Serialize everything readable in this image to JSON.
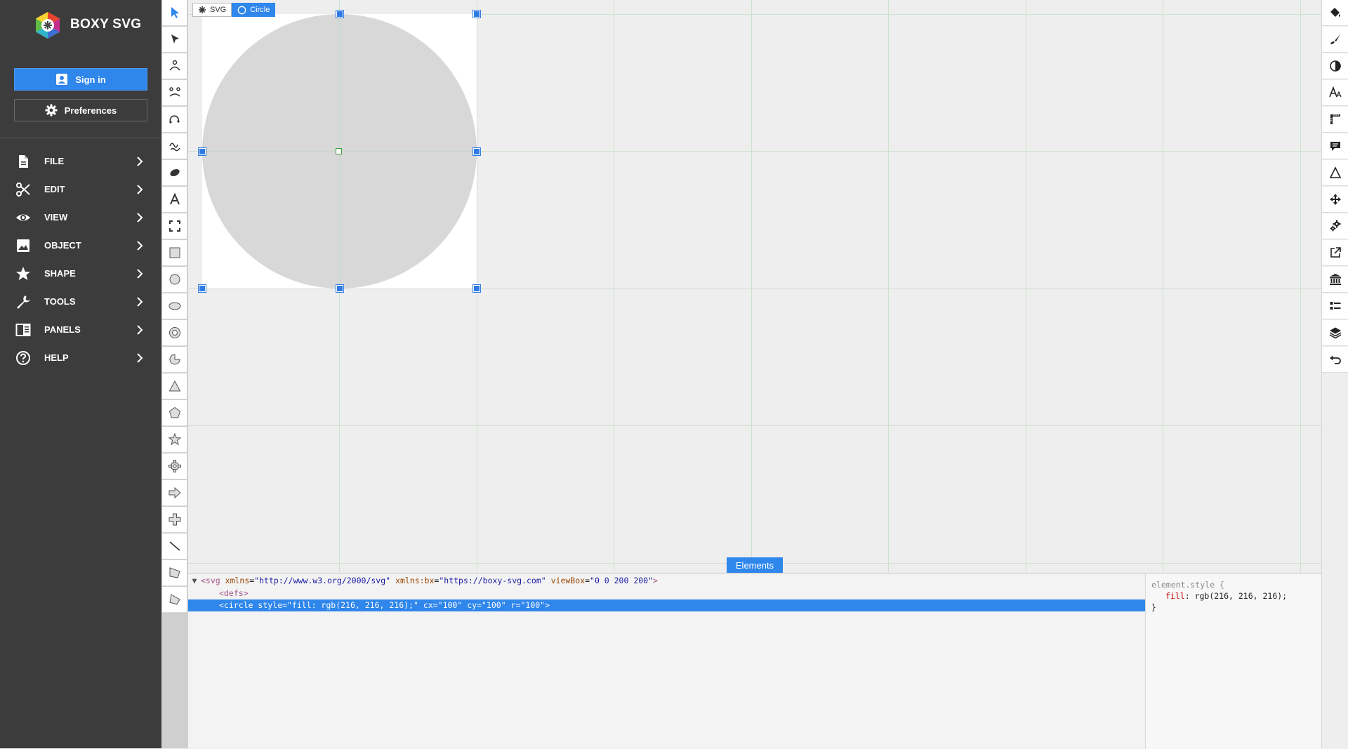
{
  "app": {
    "name": "BOXY SVG"
  },
  "sidebar": {
    "signin_label": "Sign in",
    "preferences_label": "Preferences",
    "menu": [
      {
        "label": "FILE",
        "icon": "file-icon"
      },
      {
        "label": "EDIT",
        "icon": "scissors-icon"
      },
      {
        "label": "VIEW",
        "icon": "eye-icon"
      },
      {
        "label": "OBJECT",
        "icon": "image-icon"
      },
      {
        "label": "SHAPE",
        "icon": "star-icon"
      },
      {
        "label": "TOOLS",
        "icon": "wrench-icon"
      },
      {
        "label": "PANELS",
        "icon": "panels-icon"
      },
      {
        "label": "HELP",
        "icon": "help-icon"
      }
    ]
  },
  "toolbar": {
    "tools": [
      "transform-tool-icon",
      "edit-tool-icon",
      "bezier-tool-icon",
      "pen-tool-icon",
      "arc-tool-icon",
      "freehand-tool-icon",
      "blob-brush-tool-icon",
      "text-tool-icon",
      "crop-tool-icon",
      "rectangle-tool-icon",
      "circle-tool-icon",
      "ellipse-tool-icon",
      "ring-tool-icon",
      "pie-tool-icon",
      "triangle-tool-icon",
      "polygon-tool-icon",
      "star-tool-icon",
      "gear-tool-icon",
      "arrow-tool-icon",
      "cross-tool-icon",
      "line-tool-icon",
      "polyline-tool-icon",
      "polygon-path-tool-icon"
    ]
  },
  "right_toolbar": {
    "tools": [
      "paint-bucket-icon",
      "stroke-brush-icon",
      "compositing-icon",
      "typography-icon",
      "ruler-icon",
      "comment-icon",
      "geometry-icon",
      "move-icon",
      "defs-icon",
      "export-icon",
      "library-icon",
      "objects-list-icon",
      "layers-icon",
      "history-icon"
    ]
  },
  "canvas": {
    "breadcrumb": [
      {
        "label": "SVG"
      },
      {
        "label": "Circle"
      }
    ],
    "selected_shape": {
      "fill": "#d8d8d8"
    }
  },
  "elements_panel": {
    "tab_label": "Elements",
    "svg_line": {
      "open": "<svg",
      "a1": "xmlns",
      "v1": "\"http://www.w3.org/2000/svg\"",
      "a2": "xmlns:bx",
      "v2": "\"https://boxy-svg.com\"",
      "a3": "viewBox",
      "v3": "\"0 0 200 200\"",
      "close": ">"
    },
    "defs_line": "<defs>",
    "circle_line": {
      "open": "<circle",
      "a1": "style",
      "v1": "\"fill: rgb(216, 216, 216);\"",
      "a2": "cx",
      "v2": "\"100\"",
      "a3": "cy",
      "v3": "\"100\"",
      "a4": "r",
      "v4": "\"100\"",
      "close": ">"
    },
    "style": {
      "selector": "element.style {",
      "property": "fill",
      "value": "rgb(216, 216, 216);",
      "close": "}"
    }
  },
  "colors": {
    "accent": "#2f86eb",
    "sidebar_bg": "#3c3c3c",
    "shape_fill": "#d8d8d8"
  }
}
